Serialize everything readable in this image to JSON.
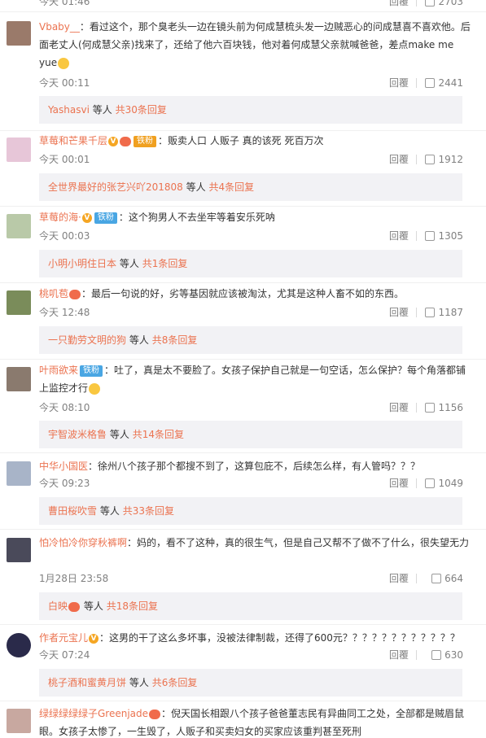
{
  "top_partial": {
    "time": "今天 01:46",
    "likes": "2703"
  },
  "reply_label": "回覆",
  "sub_suffix_people": "等人",
  "comments": [
    {
      "name": "Vbaby__",
      "text": "：看过这个，那个臭老头一边在镜头前为何成慧梳头发一边贼恶心的问成慧喜不喜欢他。后面老丈人(何成慧父亲)找来了，还给了他六百块钱，他对着何成慧父亲就喊爸爸，差点make me yue",
      "time": "今天 00:11",
      "likes": "2441",
      "sub_who": "Yashasvi",
      "sub_count": "共30条回复",
      "avatar_color": "#9a7a6a"
    },
    {
      "name": "草莓和芒果千层",
      "badge": "铁粉",
      "text": "：贩卖人口 人贩子 真的该死 死百万次",
      "time": "今天 00:01",
      "likes": "1912",
      "sub_who": "全世界最好的张艺兴吖201808",
      "sub_count": "共4条回复",
      "avatar_color": "#e7c6d8"
    },
    {
      "name": "草莓的海·",
      "badge": "铁粉",
      "text": "：这个狗男人不去坐牢等着安乐死呐",
      "time": "今天 00:03",
      "likes": "1305",
      "sub_who": "小明小明住日本",
      "sub_count": "共1条回复",
      "avatar_color": "#b9c9a8"
    },
    {
      "name": "桃叽苞",
      "text": "：最后一句说的好，劣等基因就应该被淘汰，尤其是这种人畜不如的东西。",
      "time": "今天 12:48",
      "likes": "1187",
      "sub_who": "一只勤劳文明的狗",
      "sub_count": "共8条回复",
      "avatar_color": "#7a8c5a"
    },
    {
      "name": "叶雨欲来",
      "badge": "铁粉",
      "text": "：吐了，真是太不要脸了。女孩子保护自己就是一句空话，怎么保护？每个角落都铺上监控才行",
      "time": "今天 08:10",
      "likes": "1156",
      "sub_who": "宇智波米格鲁",
      "sub_count": "共14条回复",
      "avatar_color": "#8a7a6e"
    },
    {
      "name": "中华小国医",
      "text": "：徐州八个孩子那个都搜不到了，这算包庇不，后续怎么样，有人管吗？？？",
      "time": "今天 09:23",
      "likes": "1049",
      "sub_who": "曹田桜吹雪",
      "sub_count": "共33条回复",
      "avatar_color": "#a8b4c8"
    },
    {
      "name": "怕冷怕冷你穿秋裤啊",
      "text": "：妈的，看不了这种，真的很生气，但是自己又帮不了做不了什么，很失望无力",
      "time": "1月28日 23:58",
      "likes": "664",
      "sub_who": "白映",
      "sub_count": "共18条回复",
      "avatar_color": "#4a4a5a"
    },
    {
      "name": "作者元宝儿",
      "text": "：这男的干了这么多坏事，没被法律制裁，还得了600元？？？？？？？？？？？？",
      "time": "今天 07:24",
      "likes": "630",
      "sub_who": "桃子酒和蜜黄月饼",
      "sub_count": "共6条回复",
      "avatar_color": "#2a2a4a"
    },
    {
      "name": "绿绿绿绿绿子Greenjade",
      "text": "：倪天国长相跟八个孩子爸爸董志民有异曲同工之处，全部都是贼眉鼠眼。女孩子太惨了，一生毁了，人贩子和买卖妇女的买家应该重判甚至死刑",
      "avatar_color": "#c8a8a0"
    }
  ]
}
